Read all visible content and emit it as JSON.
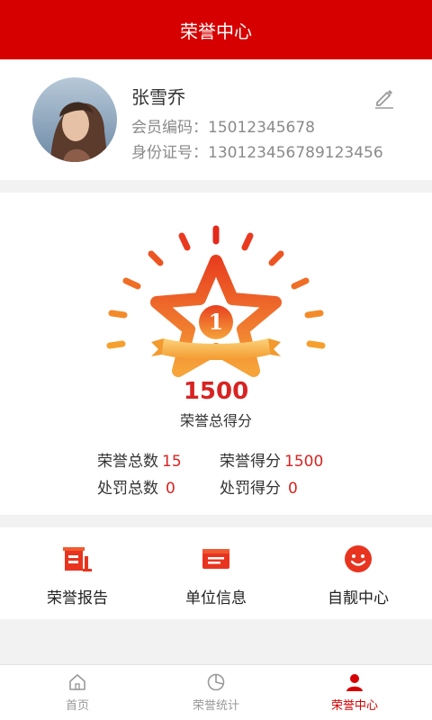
{
  "header": {
    "title": "荣誉中心"
  },
  "profile": {
    "name": "张雪乔",
    "member_no_label": "会员编码：",
    "member_no": "15012345678",
    "id_label": "身份证号：",
    "id_no": "130123456789123456"
  },
  "score": {
    "medal_rank": "1",
    "total": "1500",
    "total_label": "荣誉总得分",
    "stats": [
      {
        "label": "荣誉总数",
        "value": "15"
      },
      {
        "label": "荣誉得分",
        "value": "1500"
      },
      {
        "label": "处罚总数",
        "value": "0"
      },
      {
        "label": "处罚得分",
        "value": "0"
      }
    ]
  },
  "quick_actions": [
    {
      "label": "荣誉报告",
      "icon": "report-icon"
    },
    {
      "label": "单位信息",
      "icon": "id-card-icon"
    },
    {
      "label": "自靓中心",
      "icon": "smiley-icon"
    }
  ],
  "tabs": [
    {
      "label": "首页",
      "icon": "home-icon"
    },
    {
      "label": "荣誉统计",
      "icon": "pie-chart-icon"
    },
    {
      "label": "荣誉中心",
      "icon": "user-icon",
      "active": true
    }
  ],
  "colors": {
    "brand": "#d60000",
    "value_red": "#d82323",
    "medal_orange": "#f08a2e"
  }
}
